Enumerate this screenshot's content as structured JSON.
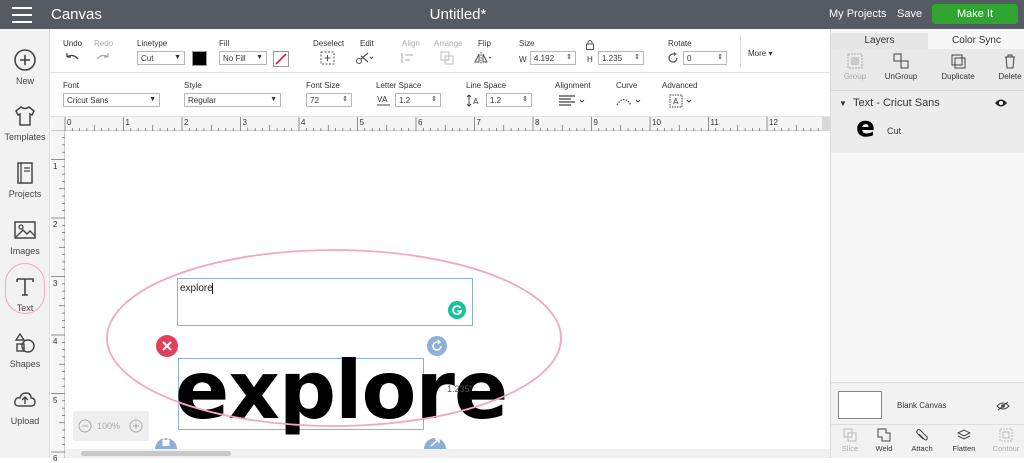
{
  "topbar": {
    "app_title": "Canvas",
    "doc_title": "Untitled*",
    "my_projects": "My Projects",
    "save": "Save",
    "make_it": "Make It"
  },
  "leftbar": {
    "items": [
      {
        "label": "New"
      },
      {
        "label": "Templates"
      },
      {
        "label": "Projects"
      },
      {
        "label": "Images"
      },
      {
        "label": "Text"
      },
      {
        "label": "Shapes"
      },
      {
        "label": "Upload"
      }
    ]
  },
  "toolbar1": {
    "undo": "Undo",
    "redo": "Redo",
    "linetype_label": "Linetype",
    "linetype_value": "Cut",
    "fill_label": "Fill",
    "fill_value": "No Fill",
    "deselect": "Deselect",
    "edit": "Edit",
    "align": "Align",
    "arrange": "Arrange",
    "flip": "Flip",
    "size_label": "Size",
    "w_label": "W",
    "w_value": "4.192",
    "h_label": "H",
    "h_value": "1.235",
    "rotate_label": "Rotate",
    "rotate_value": "0",
    "more": "More"
  },
  "toolbar2": {
    "font_label": "Font",
    "font_value": "Cricut Sans",
    "style_label": "Style",
    "style_value": "Regular",
    "font_size_label": "Font Size",
    "font_size_value": "72",
    "letter_space_label": "Letter Space",
    "letter_space_value": "1.2",
    "line_space_label": "Line Space",
    "line_space_value": "1.2",
    "alignment_label": "Alignment",
    "curve_label": "Curve",
    "advanced_label": "Advanced"
  },
  "rulers": {
    "top": [
      "0",
      "1",
      "2",
      "3",
      "4",
      "5",
      "6",
      "7",
      "8",
      "9",
      "10",
      "11",
      "12"
    ],
    "left": [
      "1",
      "2",
      "3",
      "4",
      "5",
      "6"
    ]
  },
  "canvas": {
    "input_text": "explore",
    "display_text": "explore",
    "height_label": "1.235\"",
    "zoom": "100%"
  },
  "rightpanel": {
    "tab_layers": "Layers",
    "tab_color_sync": "Color Sync",
    "group": "Group",
    "ungroup": "UnGroup",
    "duplicate": "Duplicate",
    "delete": "Delete",
    "layer_title": "Text - Cricut Sans",
    "layer_glyph": "e",
    "layer_op": "Cut",
    "blank_canvas": "Blank Canvas",
    "slice": "Slice",
    "weld": "Weld",
    "attach": "Attach",
    "flatten": "Flatten",
    "contour": "Contour"
  },
  "colors": {
    "topbar": "#545b62",
    "make_it": "#2fa52f",
    "highlight": "#f2a7c4",
    "selection": "#8fb0d6",
    "delete_handle": "#e0405a",
    "grammarly": "#15c39a"
  }
}
